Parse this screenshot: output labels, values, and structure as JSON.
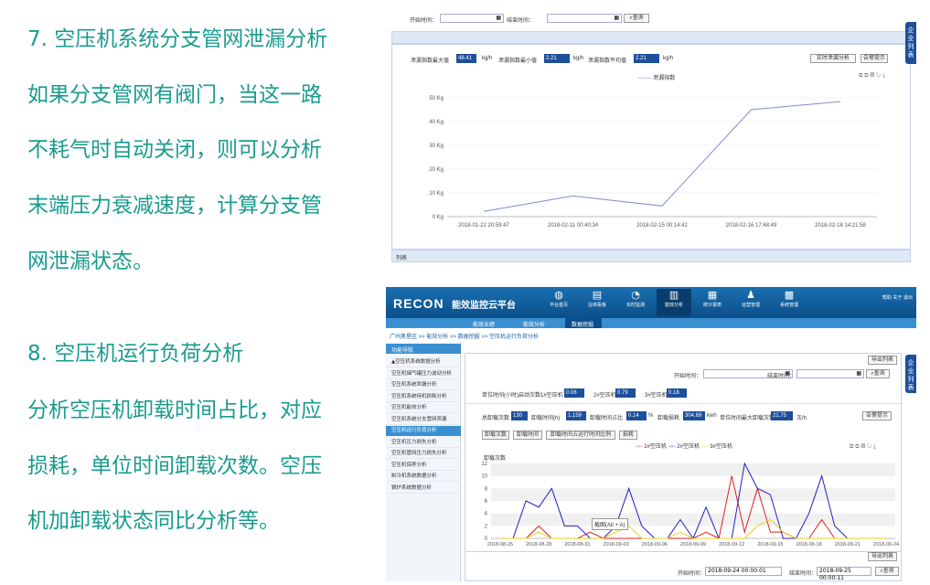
{
  "left": {
    "p1": [
      "7. 空压机系统分支管网泄漏分析",
      "如果分支管网有阀门，当这一路",
      "不耗气时自动关闭，则可以分析",
      "末端压力衰减速度，计算分支管",
      "网泄漏状态。"
    ],
    "p2": [
      "8. 空压机运行负荷分析",
      "分析空压机卸载时间占比，对应",
      "损耗，单位时间卸载次数。空压",
      "机加卸载状态同比分析等。"
    ]
  },
  "shot1": {
    "start_label": "开始时间：",
    "end_label": "结束时间：",
    "query_label": "查询",
    "max_label": "泄漏指数最大值",
    "max_value": "48.41",
    "unit1": "kg/h",
    "min_label": "泄漏指数最小值",
    "min_value": "2.21",
    "unit2": "kg/h",
    "avg_label": "泄漏指数平均值",
    "avg_value": "2.21",
    "unit3": "kg/h",
    "btn_realtime": "实时泄漏分析",
    "btn_alarm": "告警提示",
    "legend": "泄漏指数",
    "list_label": "列表",
    "side_tab": "企业列表",
    "chart_data": {
      "type": "line",
      "x": [
        "2018-01-22 20:59:47",
        "2018-02-11 00:40:34",
        "2018-02-15 00:14:42",
        "2018-02-16 17:48:49",
        "2018-02-18 14:21:58"
      ],
      "yticks": [
        "50 Kg",
        "40 Kg",
        "30 Kg",
        "20 Kg",
        "10 Kg",
        "0 Kg"
      ],
      "series": [
        {
          "name": "泄漏指数",
          "values": [
            2.2,
            8.7,
            4.5,
            45.0,
            48.4
          ]
        }
      ],
      "ylim": [
        0,
        50
      ],
      "color": "#7d8fc9"
    }
  },
  "shot2": {
    "brand": "RECON",
    "title": "能效监控云平台",
    "nav": [
      "平台首页",
      "业绩看板",
      "实时监测",
      "能效分析",
      "统计报表",
      "运营管理",
      "系统管理"
    ],
    "top_links": "帮助  关于  退出",
    "subnav": [
      "能效业绩",
      "能效分析",
      "数据挖掘"
    ],
    "breadcrumb": "广州奥垦区 >> 能效分析 >> 数据挖掘 >> 空压机运行负荷分析",
    "menu_title": "功能导航",
    "menu": [
      "▲空压机系统数据分析",
      "空压机储气罐压力波动分析",
      "空压机系统泄漏分析",
      "空压机系统待机损耗分析",
      "空压机能效分析",
      "空压机系统分支管网泄漏",
      "空压机运行负荷分析",
      "空压机压力损失分析",
      "空压机管网压力损失分析",
      "空压机保养分析",
      "制冷机系统数据分析",
      "锅炉系统数据分析"
    ],
    "export": "导出列表",
    "start_label": "开始时间：",
    "end_label": "结束时间：",
    "query_label": "查询",
    "avg_label": "单位时间(小时)启动次数",
    "c1_label": "1#空压机",
    "c1_value": "0.06",
    "c2_label": "2#空压机",
    "c2_value": "0.79",
    "c3_label": "3#空压机",
    "c3_value": "0.18",
    "total_label": "总卸载次数",
    "total_value": "130",
    "time_label": "卸载时间(h)",
    "time_value": "1.159",
    "ratio_label": "卸载时间占比",
    "ratio_value": "0.14",
    "pct": "%",
    "loss_label": "卸载损耗",
    "loss_value": "304.69",
    "loss_unit": "kwh",
    "maxunit_label": "单位时间最大卸载次数",
    "maxunit_value": "21.75",
    "per_h": "次/h",
    "alarm": "告警提示",
    "tabs": [
      "卸载次数",
      "卸载时间",
      "卸载时间占运行时间比例",
      "损耗"
    ],
    "ylabel": "卸载次数",
    "tooltip": "截图(Alt + A)",
    "export2": "导出列表",
    "start2_label": "开始时间：",
    "start2_value": "2018-09-24 00:00:01",
    "end2_label": "结束时间：",
    "end2_value": "2018-09-25 00:00:11",
    "query2": "查询",
    "side_tab": "企业列表",
    "chart_data": {
      "type": "line",
      "x": [
        "2018-08-25",
        "2018-08-28",
        "2018-08-31",
        "2018-09-03",
        "2018-09-06",
        "2018-09-09",
        "2018-09-12",
        "2018-09-15",
        "2018-09-18",
        "2018-09-21",
        "2018-09-24"
      ],
      "yticks": [
        "12",
        "10",
        "8",
        "6",
        "4",
        "2",
        "0"
      ],
      "ylim": [
        0,
        12
      ],
      "series": [
        {
          "name": "1#空压机",
          "color": "#e02020",
          "values": [
            0,
            0,
            0,
            2,
            0,
            0,
            0,
            1,
            0,
            0,
            0,
            0,
            0,
            0,
            0,
            0,
            1,
            0,
            10,
            1,
            8,
            1,
            1,
            0,
            0,
            3,
            0,
            0,
            0,
            0,
            0
          ]
        },
        {
          "name": "2#空压机",
          "color": "#2020c0",
          "values": [
            0,
            0,
            6,
            5,
            8,
            2,
            2,
            0,
            0,
            2,
            8,
            2,
            0,
            0,
            3,
            0,
            5,
            0,
            0,
            12,
            8,
            7,
            0,
            0,
            4,
            10,
            2,
            0,
            0,
            0,
            0
          ]
        },
        {
          "name": "3#空压机",
          "color": "#e8d020",
          "values": [
            0,
            0,
            0,
            1,
            0,
            0,
            0,
            0,
            0,
            1,
            2,
            0,
            0,
            0,
            1,
            0,
            0,
            0,
            0,
            0,
            2,
            3,
            1,
            0,
            0,
            0,
            0,
            0,
            0,
            0,
            0
          ]
        }
      ]
    }
  }
}
